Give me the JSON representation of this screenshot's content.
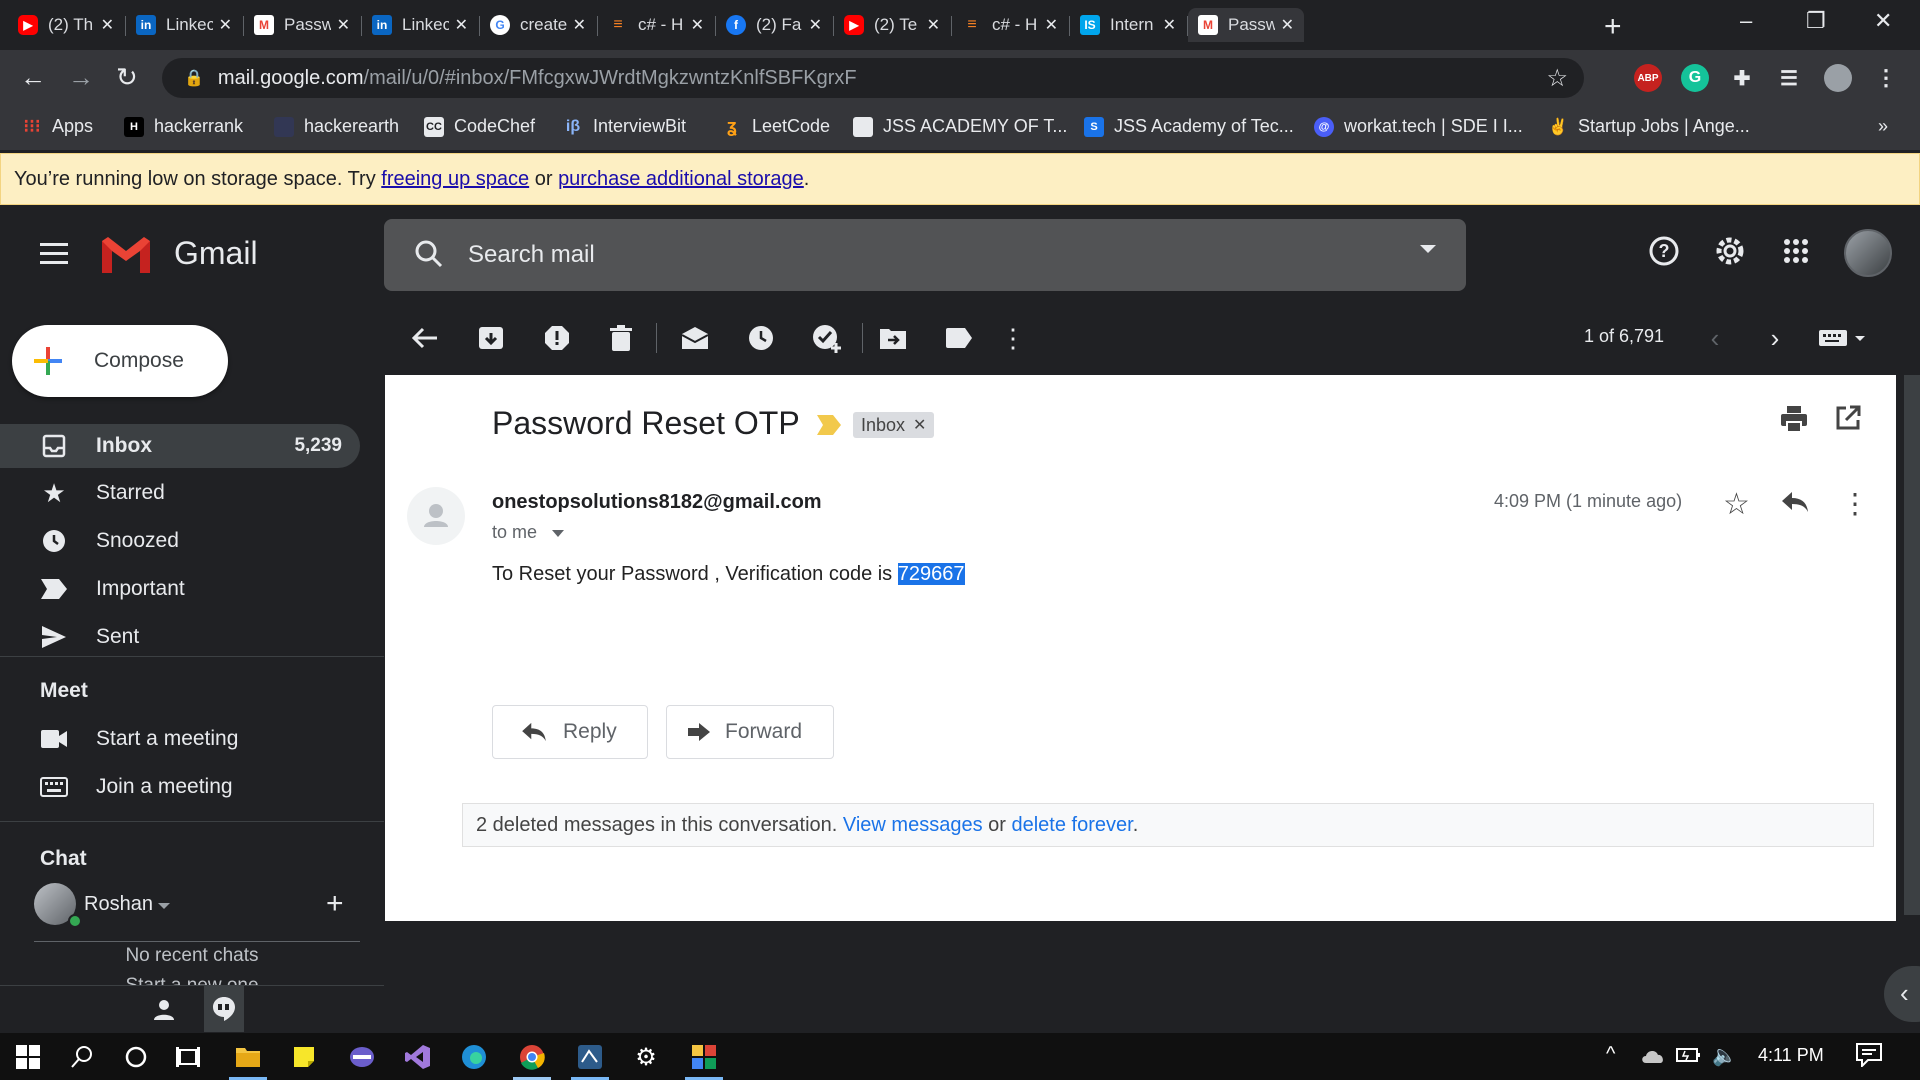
{
  "browser": {
    "tabs": [
      {
        "title": "(2) Th",
        "icon": "youtube-icon",
        "color": "#ff0000"
      },
      {
        "title": "Linkec",
        "icon": "linkedin-icon",
        "color": "#0a66c2"
      },
      {
        "title": "Passw",
        "icon": "gmail-icon",
        "color": "#ea4335"
      },
      {
        "title": "Linkec",
        "icon": "linkedin-icon",
        "color": "#0a66c2"
      },
      {
        "title": "create",
        "icon": "google-icon",
        "color": "#ffffff"
      },
      {
        "title": "c# - H",
        "icon": "stackoverflow-icon",
        "color": "#f48024"
      },
      {
        "title": "(2) Fa",
        "icon": "facebook-icon",
        "color": "#1877f2"
      },
      {
        "title": "(2) Te",
        "icon": "youtube-icon",
        "color": "#ff0000"
      },
      {
        "title": "c# - H",
        "icon": "stackoverflow-icon",
        "color": "#f48024"
      },
      {
        "title": "Intern",
        "icon": "internshala-icon",
        "color": "#00a5ec"
      },
      {
        "title": "Passw",
        "icon": "gmail-icon",
        "color": "#ea4335"
      }
    ],
    "url_host": "mail.google.com",
    "url_path": "/mail/u/0/#inbox/FMfcgxwJWrdtMgkzwntzKnlfSBFKgrxF",
    "bookmarks": [
      {
        "label": "Apps"
      },
      {
        "label": "hackerrank"
      },
      {
        "label": "hackerearth"
      },
      {
        "label": "CodeChef"
      },
      {
        "label": "InterviewBit"
      },
      {
        "label": "LeetCode"
      },
      {
        "label": "JSS ACADEMY OF T..."
      },
      {
        "label": "JSS Academy of Tec..."
      },
      {
        "label": "workat.tech | SDE I I..."
      },
      {
        "label": "Startup Jobs | Ange..."
      }
    ],
    "bookmarks_more": "»"
  },
  "banner": {
    "prefix": "You’re running low on storage space. Try ",
    "link1": "freeing up space",
    "middle": " or ",
    "link2": "purchase additional storage",
    "suffix": "."
  },
  "gmail": {
    "product": "Gmail",
    "search_placeholder": "Search mail"
  },
  "sidebar": {
    "compose": "Compose",
    "items": [
      {
        "label": "Inbox",
        "count": "5,239",
        "icon": "inbox-icon"
      },
      {
        "label": "Starred",
        "count": "",
        "icon": "star-icon"
      },
      {
        "label": "Snoozed",
        "count": "",
        "icon": "clock-icon"
      },
      {
        "label": "Important",
        "count": "",
        "icon": "important-icon"
      },
      {
        "label": "Sent",
        "count": "",
        "icon": "send-icon"
      }
    ],
    "meet_header": "Meet",
    "meet_items": [
      {
        "label": "Start a meeting",
        "icon": "video-icon"
      },
      {
        "label": "Join a meeting",
        "icon": "keyboard-icon"
      }
    ],
    "chat_header": "Chat",
    "chat_user": "Roshan",
    "no_chats": "No recent chats",
    "start_new": "Start a new one"
  },
  "toolbar": {
    "page_count": "1 of 6,791"
  },
  "message": {
    "subject": "Password Reset OTP",
    "label_chip": "Inbox",
    "sender": "onestopsolutions8182@gmail.com",
    "to": "to me",
    "time": "4:09 PM (1 minute ago)",
    "body_prefix": "To Reset your Password , Verification code is ",
    "otp": "729667",
    "reply": "Reply",
    "forward": "Forward",
    "deleted_prefix": "2 deleted messages in this conversation. ",
    "view_messages": "View messages",
    "deleted_or": " or ",
    "delete_forever": "delete forever",
    "deleted_suffix": "."
  },
  "taskbar": {
    "time": "4:11 PM"
  },
  "colors": {
    "accent": "#1a73e8",
    "banner_bg": "#fdefc3",
    "dark_bg": "#202124"
  }
}
